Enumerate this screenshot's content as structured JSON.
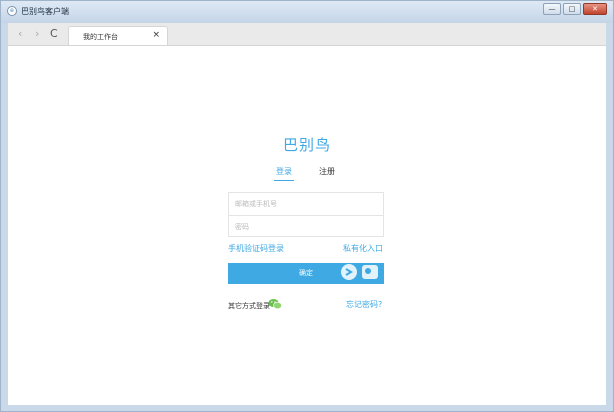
{
  "window": {
    "title": "巴别鸟客户端",
    "controls": {
      "minimize": "—",
      "maximize": "□",
      "close": "✕"
    }
  },
  "browser": {
    "back": "‹",
    "forward": "›",
    "reload": "C",
    "tab": {
      "label": "我的工作台",
      "close": "×"
    }
  },
  "login": {
    "brand": "巴别鸟",
    "tabs": {
      "login": "登录",
      "register": "注册"
    },
    "account_placeholder": "邮箱或手机号",
    "password_placeholder": "密码",
    "sms_login_link": "手机验证码登录",
    "private_entry_link": "私有化入口",
    "submit_label": "确定",
    "other_methods_label": "其它方式登录",
    "forgot_password_link": "忘记密码?"
  },
  "colors": {
    "accent": "#3ea9e3",
    "wechat": "#6bbf4e"
  },
  "icons": {
    "app": "app-icon",
    "wechat": "wechat-icon"
  }
}
